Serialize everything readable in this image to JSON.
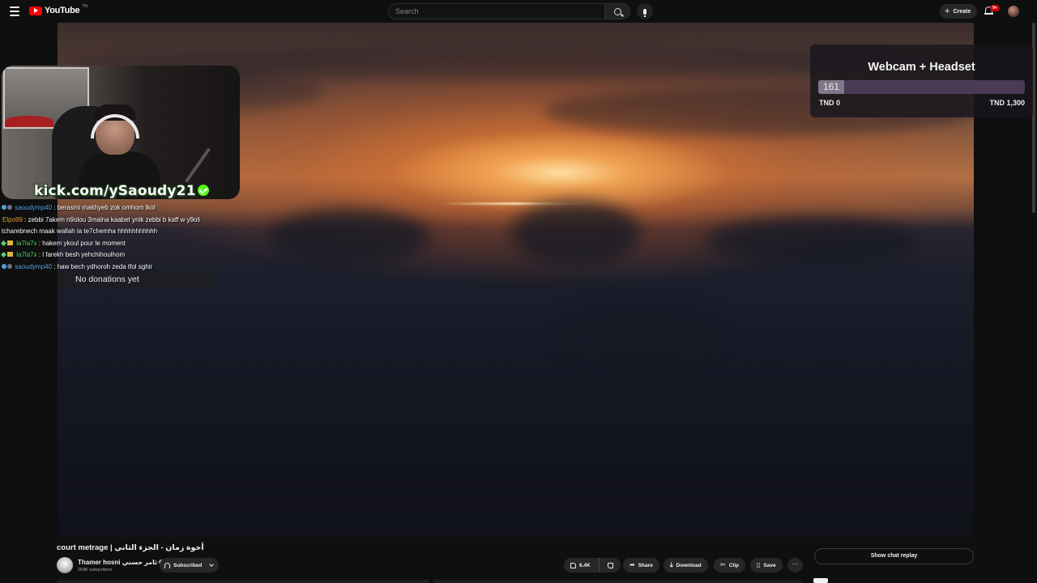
{
  "header": {
    "logo_text": "YouTube",
    "logo_region": "TN",
    "search_placeholder": "Search",
    "create_label": "Create",
    "notification_count": "9+"
  },
  "overlay": {
    "kick_url": "kick.com/ySaoudy21",
    "chat": [
      {
        "user": "saoudymp40",
        "text": " : berasmi makhyeb zok omhom lkol",
        "user_color": "#5aa7e6",
        "icon": "#49a6e0"
      },
      {
        "user": "Elpo99",
        "text": " : zebbi 7akem n9olou 3malna kaabet ynik zebbi b kaff w y9oli tcharebnech maak wallah la te7chemha hhhhhhhhhhh",
        "user_color": "#e6a63d",
        "icon": ""
      },
      {
        "user": "la7la7x",
        "text": " : hakem ykoul pour le moment",
        "user_color": "#53d36b",
        "icon": "#53d36b"
      },
      {
        "user": "la7la7x",
        "text": " : l farekh besh yehchihoulhom",
        "user_color": "#53d36b",
        "icon": "#53d36b"
      },
      {
        "user": "saoudymp40",
        "text": " : haw bech ydhoroh zeda tfol sghir",
        "user_color": "#5aa7e6",
        "icon": "#49a6e0"
      }
    ],
    "donations_text": "No donations yet",
    "goal": {
      "title": "Webcam + Headset",
      "current_display": "161",
      "current": 161,
      "target": 1300,
      "min_label": "TND 0",
      "max_label": "TND 1,300"
    }
  },
  "video": {
    "title": "court metrage | أخوة زمان - الجزء الثاني",
    "channel_name": "Thamer hosni ثامر حسني",
    "subscribers": "264K subscribers",
    "subscribed_label": "Subscribed",
    "likes": "6.4K",
    "share_label": "Share",
    "download_label": "Download",
    "clip_label": "Clip",
    "save_label": "Save",
    "more_label": "···"
  },
  "sidebar": {
    "show_chat_replay": "Show chat replay"
  }
}
